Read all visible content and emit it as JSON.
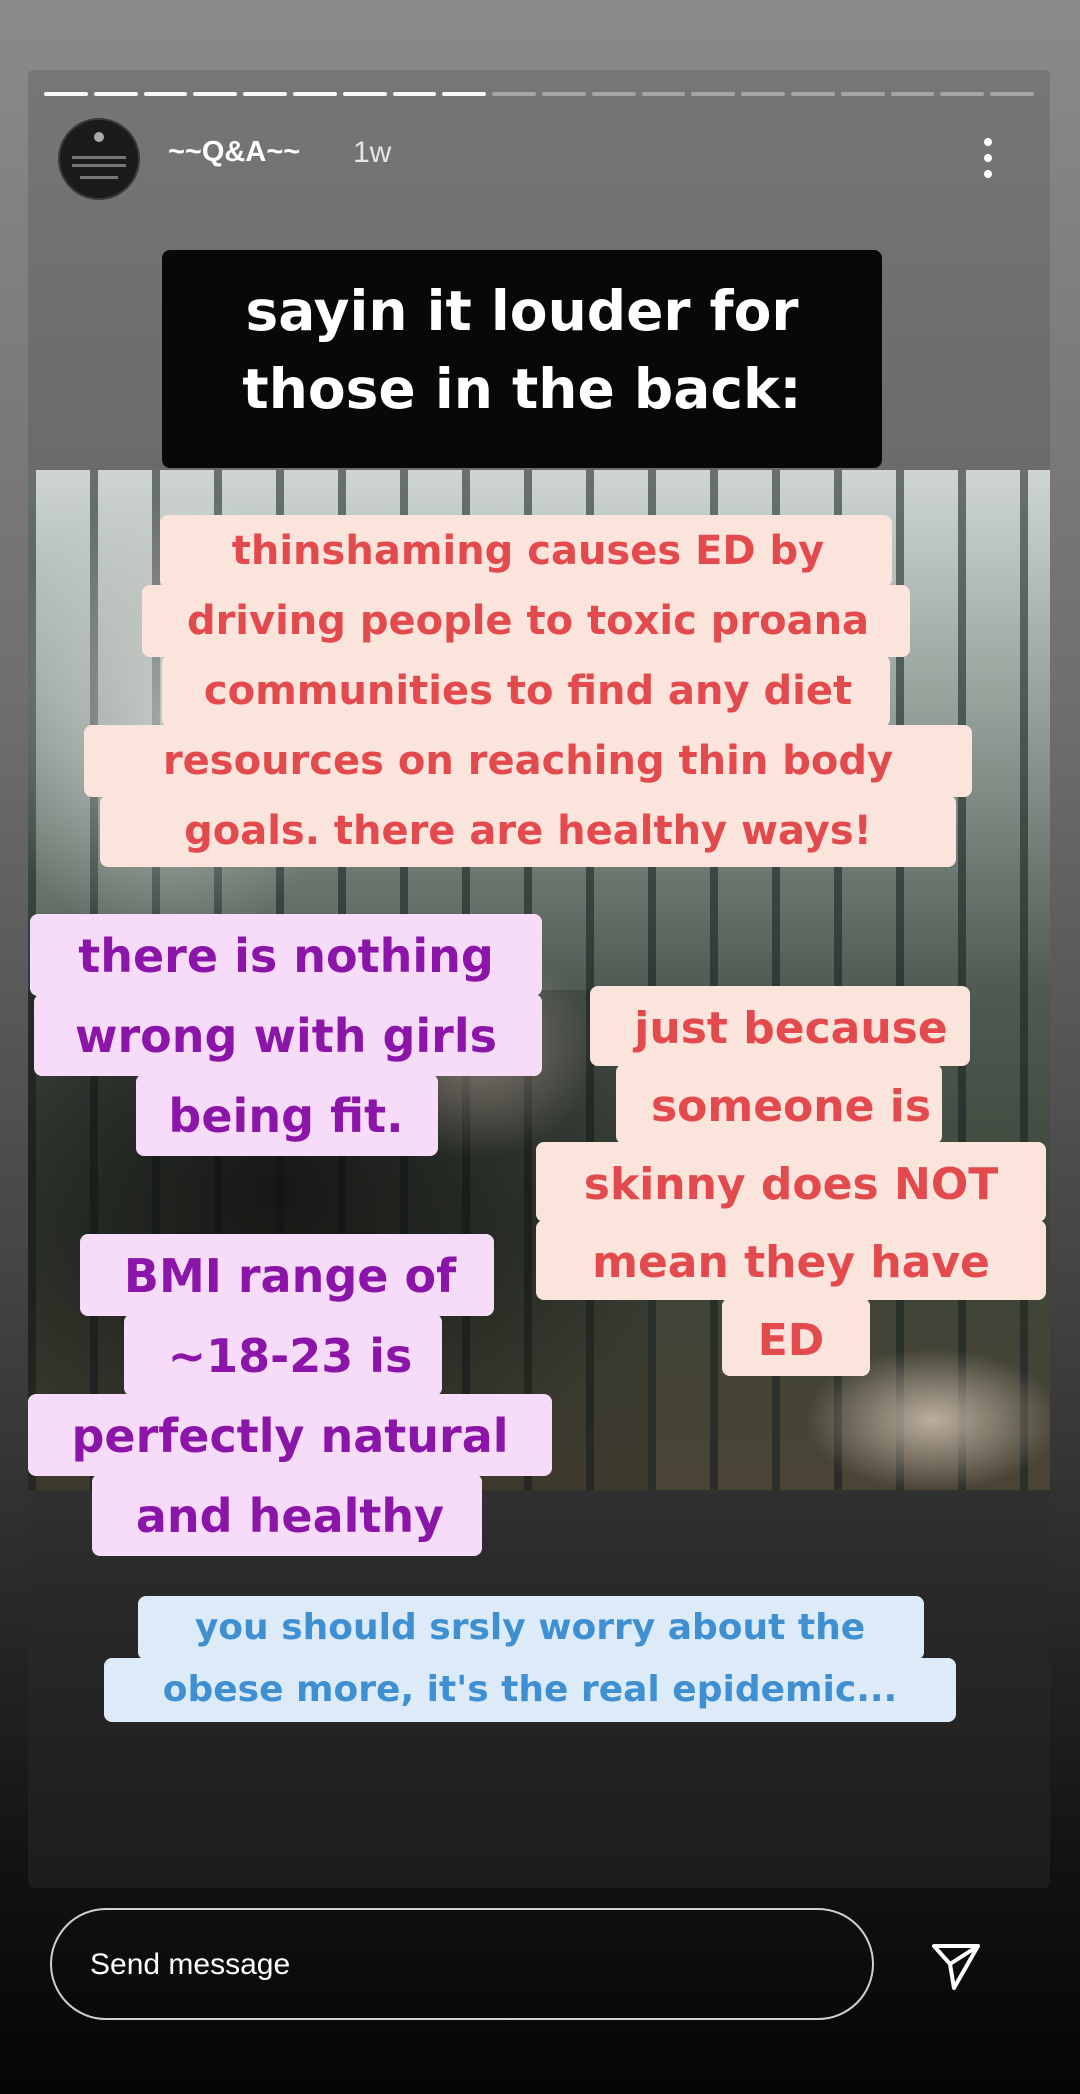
{
  "story": {
    "segments_total": 20,
    "segments_done": 9
  },
  "header": {
    "username": "~~Q&A~~",
    "time": "1w",
    "avatar_icon": "profile-avatar",
    "more_icon": "vertical-dots-icon"
  },
  "stickers": {
    "heading_line1": "sayin it louder for",
    "heading_line2": "those in the back:",
    "thin_line1": "thinshaming causes ED by",
    "thin_line2": "driving people to toxic proana",
    "thin_line3": "communities to find any diet",
    "thin_line4": "resources on reaching thin body",
    "thin_line5": "goals. there are healthy ways!",
    "fit_line1": "there is nothing",
    "fit_line2": "wrong with girls",
    "fit_line3": "being fit.",
    "skinny_line1": "just because",
    "skinny_line2": "someone is",
    "skinny_line3": "skinny does NOT",
    "skinny_line4": "mean they have",
    "skinny_line5": "ED",
    "bmi_line1": "BMI range of",
    "bmi_line2": "~18-23 is",
    "bmi_line3": "perfectly natural",
    "bmi_line4": "and healthy",
    "obese_line1": "you should srsly worry about the",
    "obese_line2": "obese more, it's the real epidemic..."
  },
  "colors": {
    "heading_bg": "#080808",
    "peach_bg": "#fbe4dc",
    "peach_text": "#e24a4d",
    "pink_bg": "#f7dcf9",
    "pink_text": "#8a15a8",
    "blue_bg": "#dcebf7",
    "blue_text": "#3f8fd3"
  },
  "footer": {
    "message_placeholder": "Send message",
    "send_icon": "paper-plane-icon"
  }
}
